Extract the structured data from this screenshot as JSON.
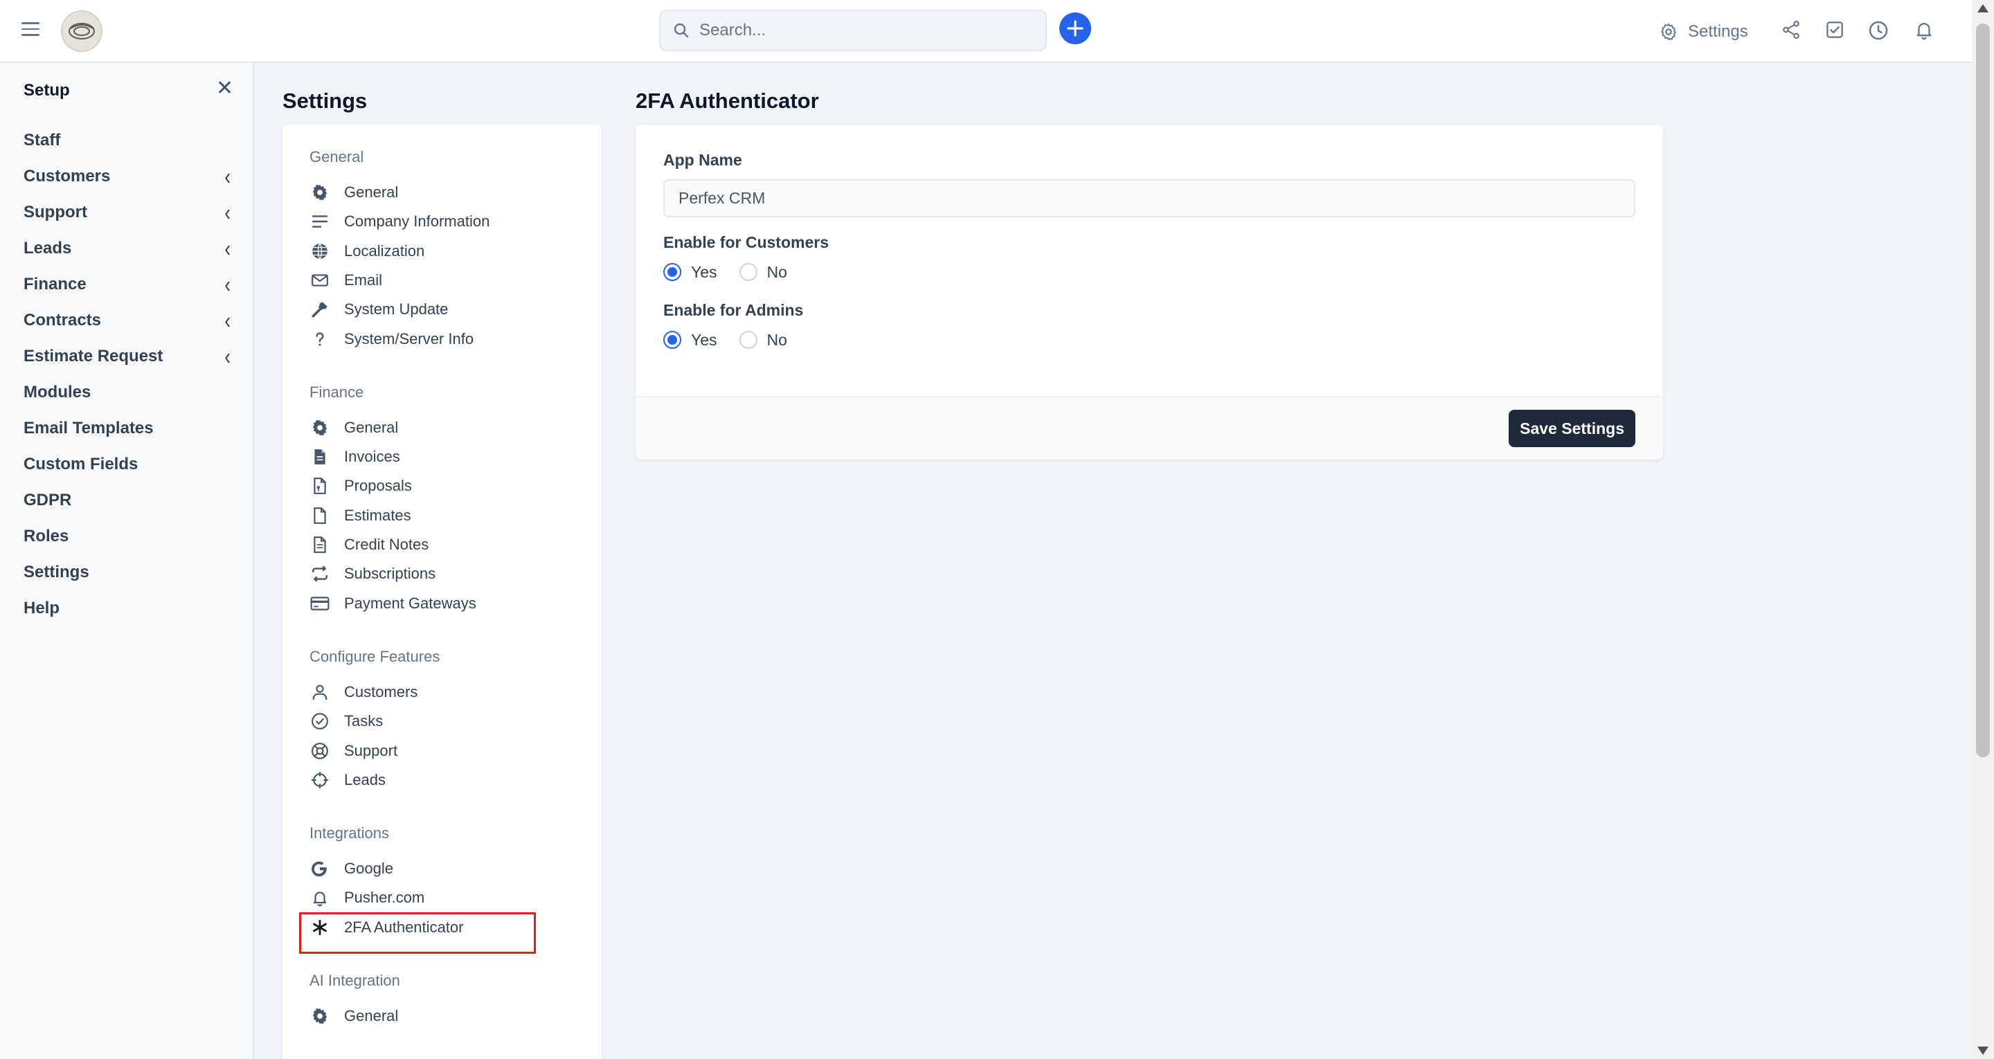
{
  "topbar": {
    "search_placeholder": "Search...",
    "plus_label": "+",
    "settings_label": "Settings",
    "icons": [
      "menu-icon",
      "search-icon",
      "plus-icon",
      "gear-icon",
      "share-icon",
      "checkbox-icon",
      "clock-icon",
      "bell-icon"
    ]
  },
  "setup": {
    "title": "Setup",
    "close": "✕",
    "items": [
      {
        "label": "Staff",
        "chevron": ""
      },
      {
        "label": "Customers",
        "chevron": "‹"
      },
      {
        "label": "Support",
        "chevron": "‹"
      },
      {
        "label": "Leads",
        "chevron": "‹"
      },
      {
        "label": "Finance",
        "chevron": "‹"
      },
      {
        "label": "Contracts",
        "chevron": "‹"
      },
      {
        "label": "Estimate Request",
        "chevron": "‹"
      },
      {
        "label": "Modules",
        "chevron": ""
      },
      {
        "label": "Email Templates",
        "chevron": ""
      },
      {
        "label": "Custom Fields",
        "chevron": ""
      },
      {
        "label": "GDPR",
        "chevron": ""
      },
      {
        "label": "Roles",
        "chevron": ""
      },
      {
        "label": "Settings",
        "chevron": ""
      },
      {
        "label": "Help",
        "chevron": ""
      }
    ]
  },
  "settings": {
    "heading": "Settings",
    "groups": [
      {
        "title": "General",
        "items": [
          {
            "label": "General",
            "icon": "gear-icon"
          },
          {
            "label": "Company Information",
            "icon": "lines-icon"
          },
          {
            "label": "Localization",
            "icon": "globe-icon"
          },
          {
            "label": "Email",
            "icon": "envelope-icon"
          },
          {
            "label": "System Update",
            "icon": "hammer-icon"
          },
          {
            "label": "System/Server Info",
            "icon": "question-icon"
          }
        ]
      },
      {
        "title": "Finance",
        "items": [
          {
            "label": "General",
            "icon": "gear-icon"
          },
          {
            "label": "Invoices",
            "icon": "file-solid-icon"
          },
          {
            "label": "Proposals",
            "icon": "file-doc-icon"
          },
          {
            "label": "Estimates",
            "icon": "file-icon"
          },
          {
            "label": "Credit Notes",
            "icon": "file-lines-icon"
          },
          {
            "label": "Subscriptions",
            "icon": "repeat-icon"
          },
          {
            "label": "Payment Gateways",
            "icon": "credit-card-icon"
          }
        ]
      },
      {
        "title": "Configure Features",
        "items": [
          {
            "label": "Customers",
            "icon": "user-icon"
          },
          {
            "label": "Tasks",
            "icon": "check-circle-icon"
          },
          {
            "label": "Support",
            "icon": "lifebuoy-icon"
          },
          {
            "label": "Leads",
            "icon": "crosshair-icon"
          }
        ]
      },
      {
        "title": "Integrations",
        "items": [
          {
            "label": "Google",
            "icon": "google-icon"
          },
          {
            "label": "Pusher.com",
            "icon": "bell-icon"
          },
          {
            "label": "2FA Authenticator",
            "icon": "asterisk-icon"
          }
        ]
      },
      {
        "title": "AI Integration",
        "items": [
          {
            "label": "General",
            "icon": "gear-icon"
          }
        ]
      }
    ]
  },
  "form": {
    "heading": "2FA Authenticator",
    "app_name_label": "App Name",
    "app_name_value": "Perfex CRM",
    "customers_label": "Enable for Customers",
    "customers_value": "Yes",
    "admins_label": "Enable for Admins",
    "admins_value": "Yes",
    "yes_label": "Yes",
    "no_label": "No",
    "save_label": "Save Settings"
  },
  "colors": {
    "accent": "#2563eb",
    "dark_button": "#1e293b",
    "highlight": "#e0201c"
  }
}
